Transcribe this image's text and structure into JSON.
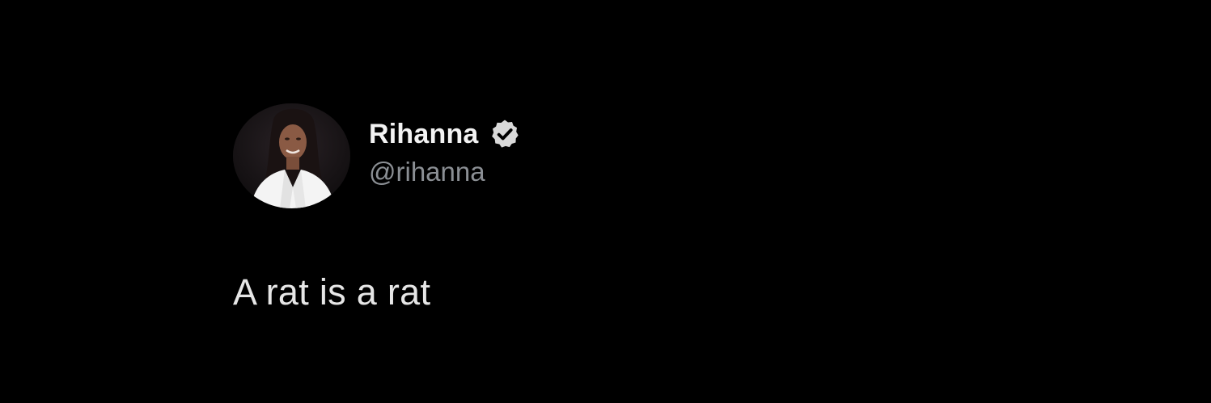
{
  "tweet": {
    "author": {
      "display_name": "Rihanna",
      "handle": "@rihanna",
      "verified": true,
      "avatar_icon": "profile-photo"
    },
    "text": "A rat is a rat"
  },
  "colors": {
    "background": "#000000",
    "name": "#f2f2f2",
    "handle": "#8b8f94",
    "text": "#e6e6e6",
    "verified_badge": "#d9d9d9"
  }
}
